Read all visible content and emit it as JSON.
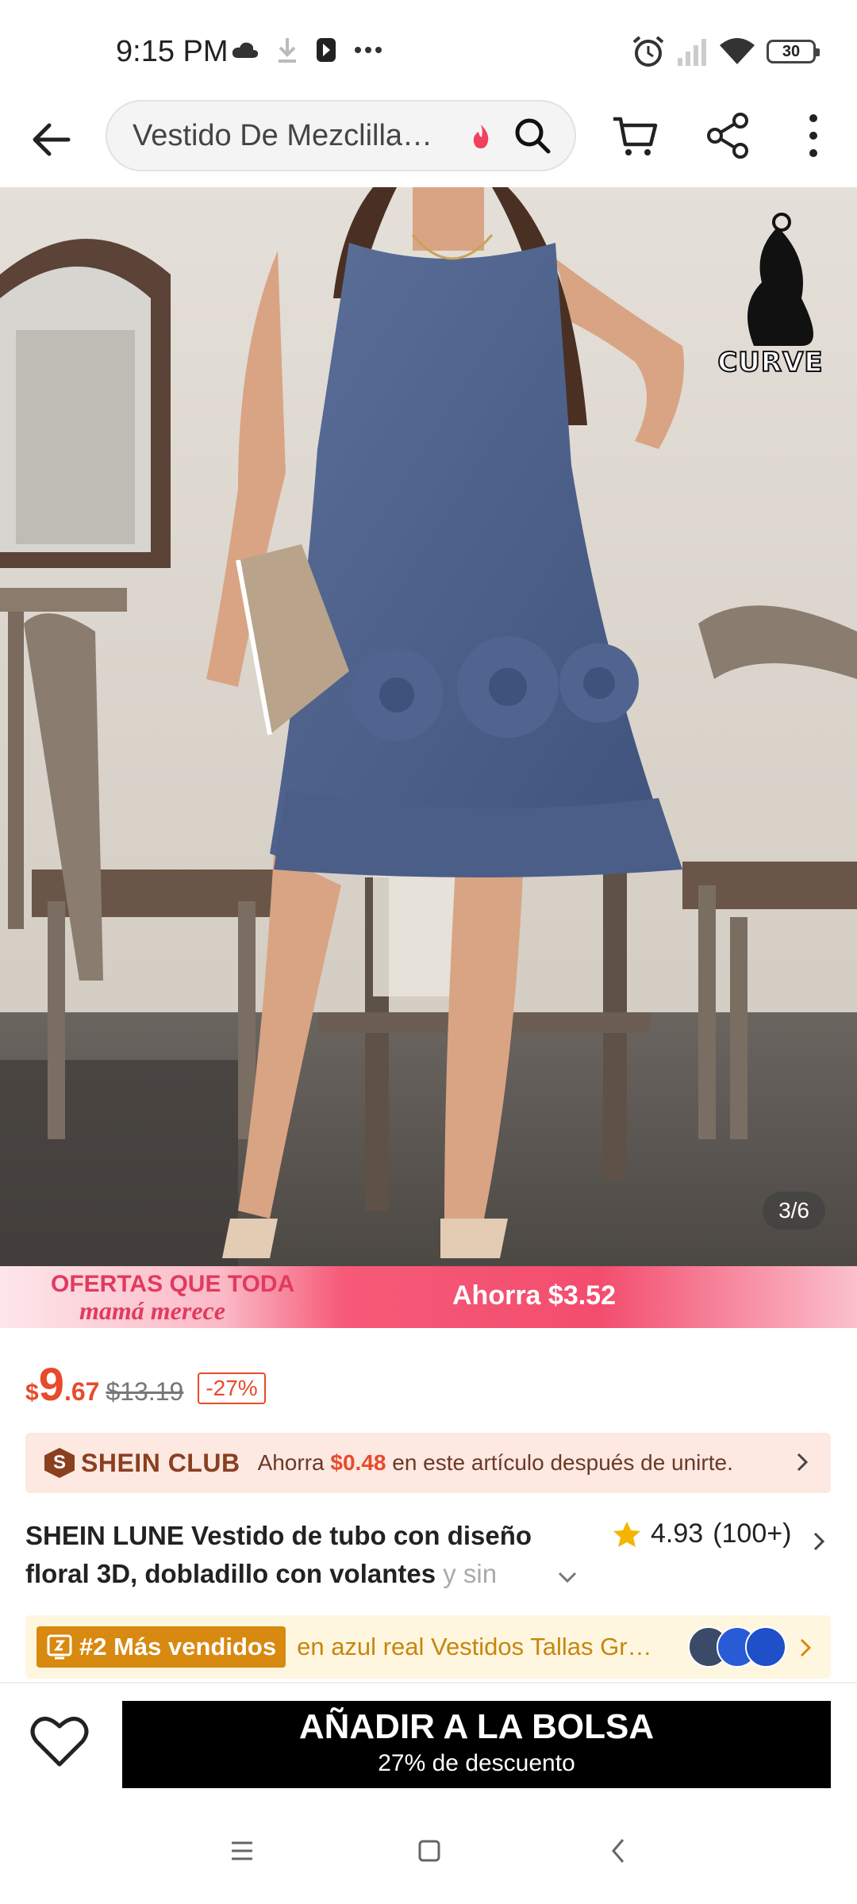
{
  "status_bar": {
    "time": "9:15 PM",
    "battery": "30"
  },
  "search": {
    "query": "Vestido De Mezclilla…"
  },
  "product_image": {
    "counter": "3/6",
    "badge": "CURVE"
  },
  "promo": {
    "title": "OFERTAS QUE TODA",
    "subtitle": "mamá merece",
    "savings": "Ahorra $3.52"
  },
  "price": {
    "currency": "$",
    "integer": "9",
    "decimal": ".67",
    "original": "$13.19",
    "discount": "-27%"
  },
  "club": {
    "icon_letter": "S",
    "name": "SHEIN CLUB",
    "text_before": "Ahorra ",
    "amount": "$0.48",
    "text_after": " en este artículo después de unirte."
  },
  "product": {
    "title_main": "SHEIN LUNE Vestido de tubo con diseño floral 3D, dobladillo con volantes ",
    "title_fade": "y sin",
    "rating": "4.93",
    "rating_count": "(100+)"
  },
  "best_seller": {
    "tag": "#2 Más vendidos",
    "text": "en azul real Vestidos Tallas Grandes"
  },
  "actions": {
    "add_label": "AÑADIR A LA BOLSA",
    "add_sub": "27% de descuento"
  },
  "colors": {
    "accent": "#e84b2b",
    "club_brown": "#8a3f1f",
    "best_orange": "#d8890f",
    "promo_pink": "#f34d6e"
  }
}
